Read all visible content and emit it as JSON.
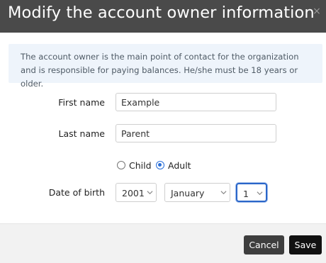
{
  "dialog": {
    "title": "Modify the account owner information",
    "close_symbol": "×"
  },
  "info": {
    "text": "The account owner is the main point of contact for the organization and is responsible for paying balances. He/she must be 18 years or older."
  },
  "form": {
    "first_name": {
      "label": "First name",
      "value": "Example"
    },
    "last_name": {
      "label": "Last name",
      "value": "Parent"
    },
    "age_type": {
      "options": [
        {
          "label": "Child",
          "checked": false
        },
        {
          "label": "Adult",
          "checked": true
        }
      ]
    },
    "date_of_birth": {
      "label": "Date of birth",
      "year": "2001",
      "month": "January",
      "day": "1"
    }
  },
  "footer": {
    "cancel_label": "Cancel",
    "save_label": "Save"
  },
  "colors": {
    "header_bg": "#4a4a4a",
    "info_bg": "#eef4fb",
    "accent_blue": "#2b6fd8",
    "save_bg": "#111111",
    "cancel_bg": "#3e3e3e"
  },
  "icons": {
    "close": "close-icon",
    "select_arrow": "chevron-down-icon"
  }
}
